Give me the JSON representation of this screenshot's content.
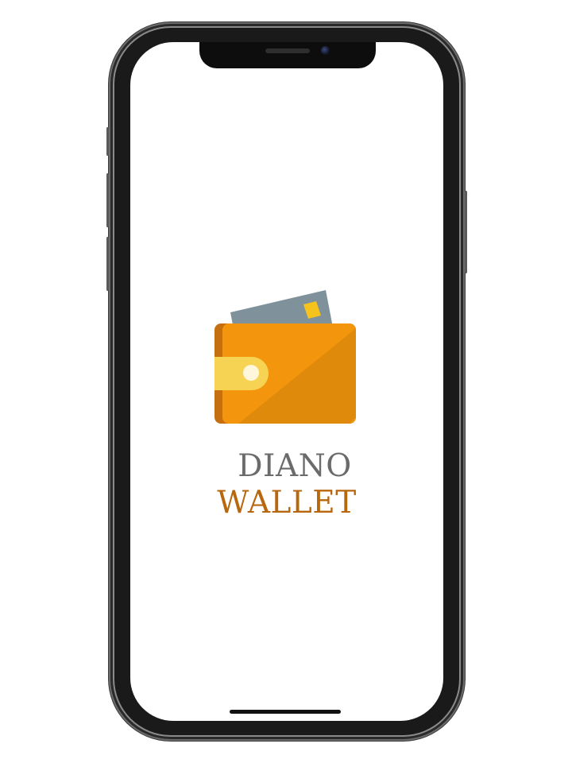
{
  "brand": {
    "line1": "DIANO",
    "line2": "WALLET"
  },
  "colors": {
    "wallet_body": "#f4960d",
    "wallet_shade": "#e08a0b",
    "wallet_edge": "#c56f10",
    "card": "#7f919b",
    "card_chip": "#f6c21c",
    "clasp": "#f7d354",
    "title_gray": "#6b6b6b",
    "title_brown": "#b7670d"
  },
  "icons": {
    "logo": "wallet-icon"
  }
}
